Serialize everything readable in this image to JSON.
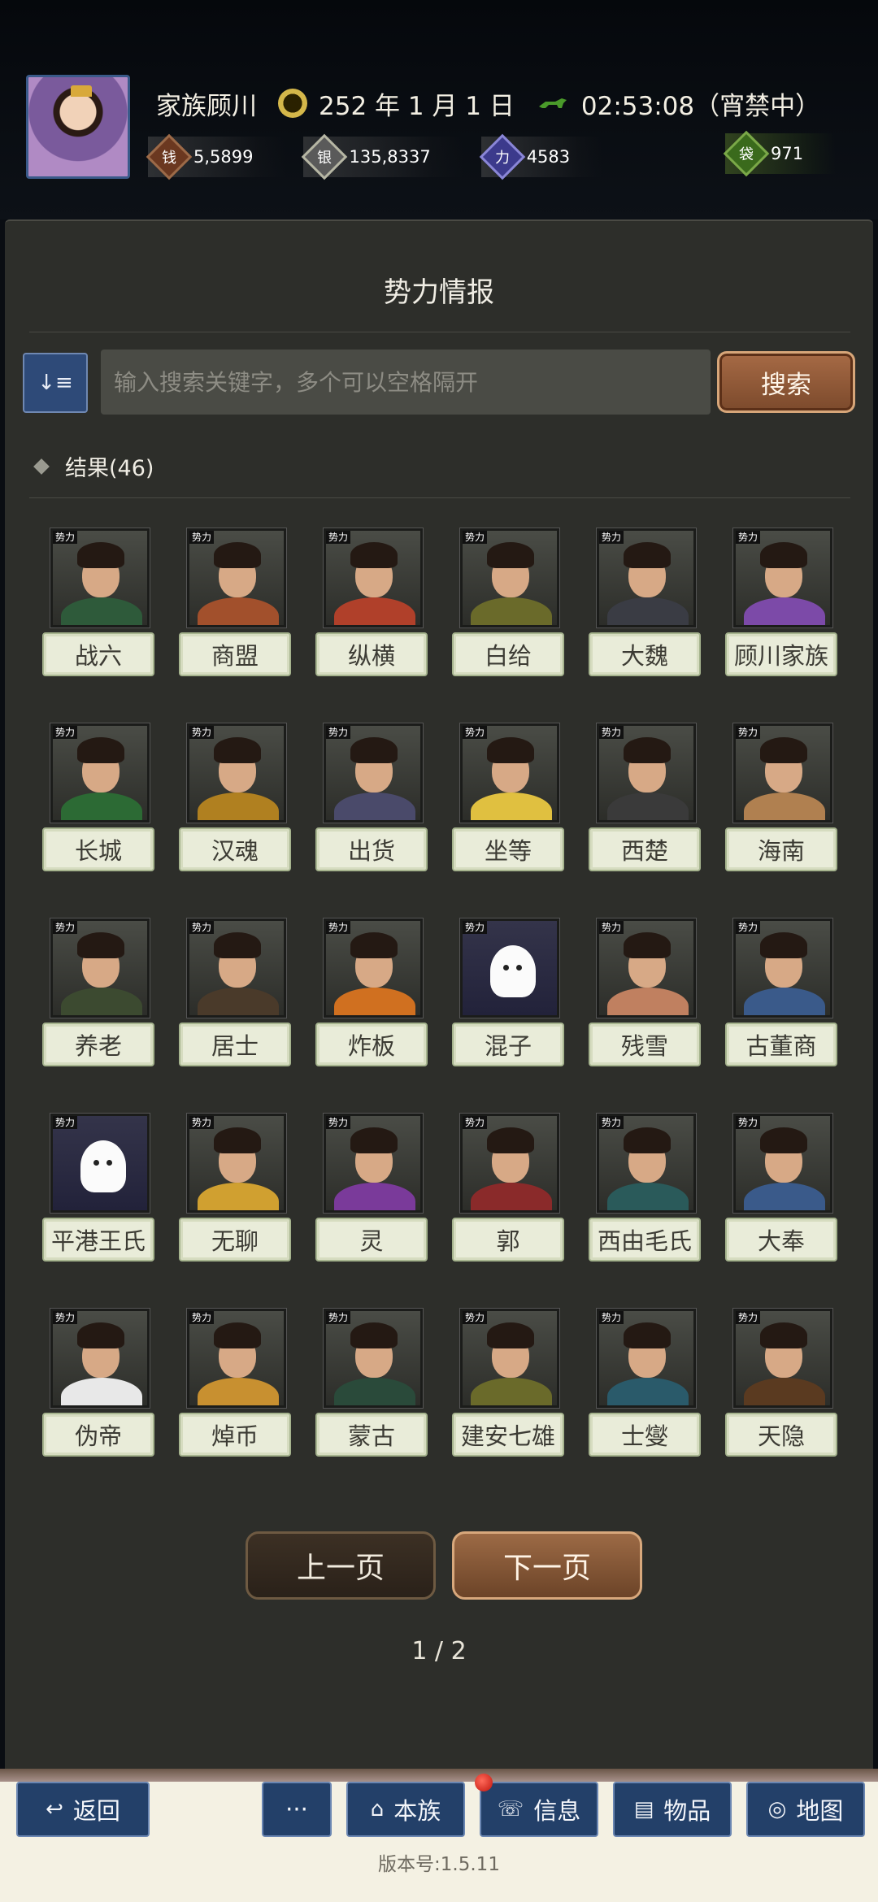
{
  "header": {
    "clan_name": "家族顾川",
    "calendar_icon": "calendar-seal-icon",
    "date": "252 年 1 月 1 日",
    "time": "02:53:08（宵禁中）",
    "resources": [
      {
        "icon": "copper-coin-icon",
        "value": "5,5899"
      },
      {
        "icon": "silver-ingot-icon",
        "value": "135,8337"
      },
      {
        "icon": "power-icon",
        "value": "4583"
      },
      {
        "icon": "money-bag-icon",
        "value": "971"
      }
    ]
  },
  "panel": {
    "title": "势力情报",
    "search_placeholder": "输入搜索关键字，多个可以空格隔开",
    "search_button": "搜索",
    "result_label": "结果(46)",
    "tag_label": "势力",
    "factions": [
      "战六",
      "商盟",
      "纵横",
      "白给",
      "大魏",
      "顾川家族",
      "长城",
      "汉魂",
      "出货",
      "坐等",
      "西楚",
      "海南",
      "养老",
      "居士",
      "炸板",
      "混子",
      "残雪",
      "古董商",
      "平港王氏",
      "无聊",
      "灵",
      "郭",
      "西由毛氏",
      "大奉",
      "伪帝",
      "焯币",
      "蒙古",
      "建安七雄",
      "士燮",
      "天隐"
    ],
    "prev_button": "上一页",
    "next_button": "下一页",
    "page_indicator": "1 / 2"
  },
  "bottom_nav": {
    "back": "返回",
    "more": "···",
    "clan": "本族",
    "info": "信息",
    "items": "物品",
    "map": "地图"
  },
  "version": "版本号:1.5.11"
}
